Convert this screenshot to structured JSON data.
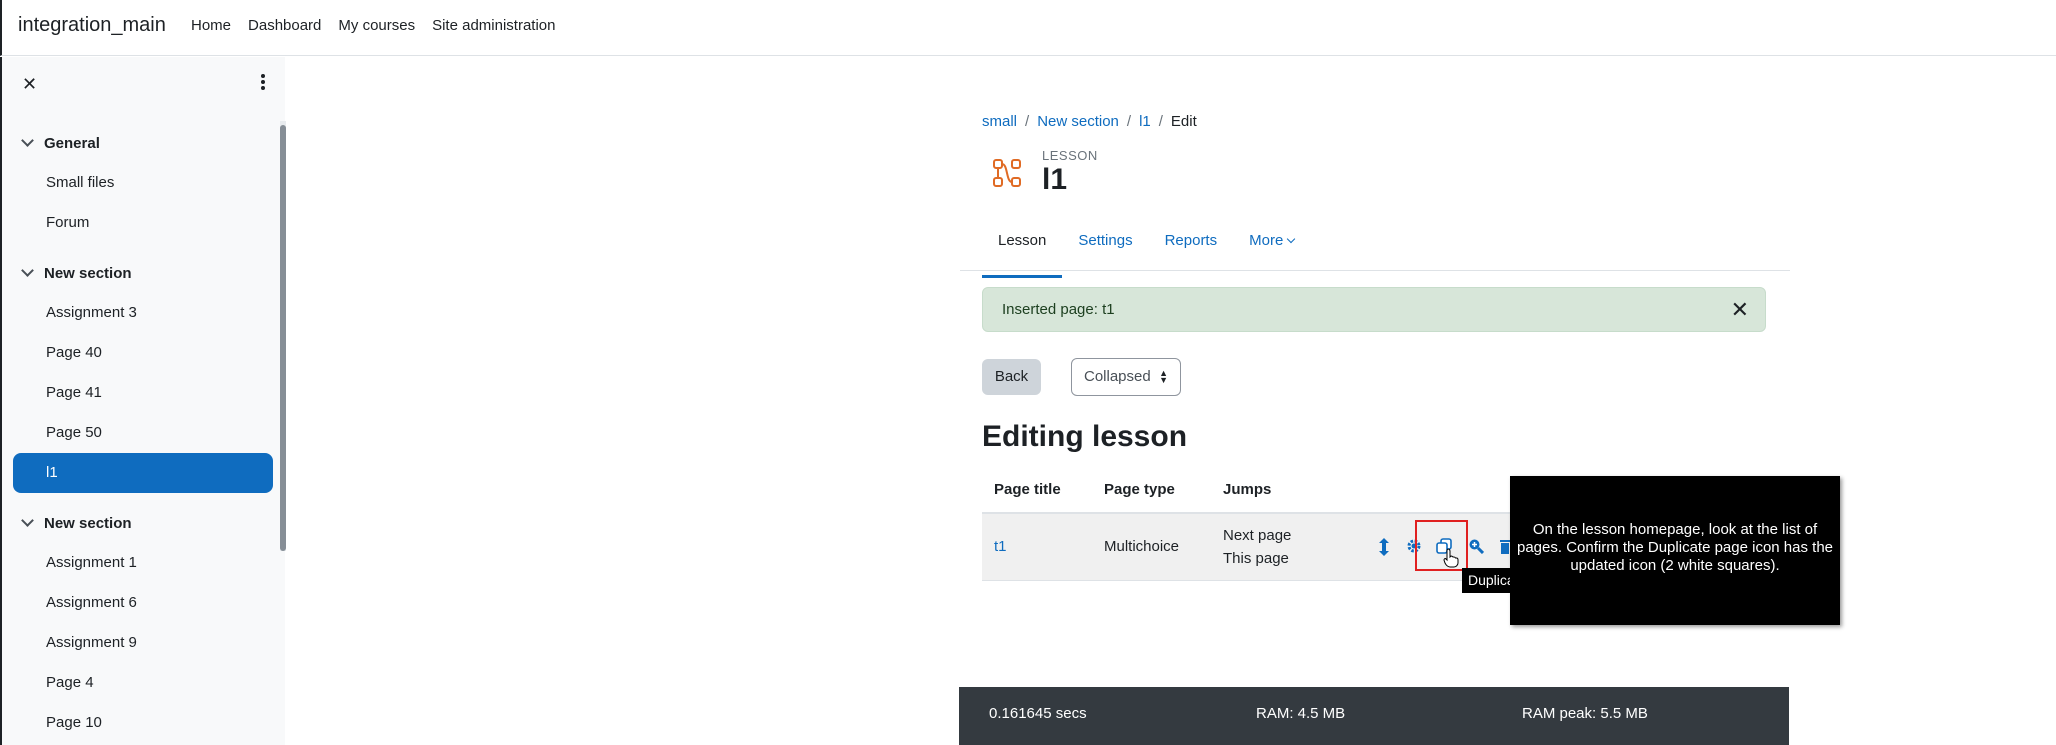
{
  "navbar": {
    "brand": "integration_main",
    "links": [
      "Home",
      "Dashboard",
      "My courses",
      "Site administration"
    ]
  },
  "drawer": {
    "sections": [
      {
        "title": "General",
        "items": [
          {
            "label": "Small files"
          },
          {
            "label": "Forum"
          }
        ]
      },
      {
        "title": "New section",
        "items": [
          {
            "label": "Assignment 3"
          },
          {
            "label": "Page 40"
          },
          {
            "label": "Page 41"
          },
          {
            "label": "Page 50"
          },
          {
            "label": "l1",
            "active": true
          }
        ]
      },
      {
        "title": "New section",
        "items": [
          {
            "label": "Assignment 1"
          },
          {
            "label": "Assignment 6"
          },
          {
            "label": "Assignment 9"
          },
          {
            "label": "Page 4"
          },
          {
            "label": "Page 10"
          }
        ]
      }
    ]
  },
  "breadcrumb": {
    "items": [
      "small",
      "New section",
      "l1"
    ],
    "current": "Edit",
    "separator": "/"
  },
  "module": {
    "type_label": "LESSON",
    "title": "l1"
  },
  "tabs": {
    "lesson": "Lesson",
    "settings": "Settings",
    "reports": "Reports",
    "more": "More"
  },
  "alert": {
    "text": "Inserted page: t1",
    "close": "✕"
  },
  "controls": {
    "back": "Back",
    "select_value": "Collapsed"
  },
  "heading": "Editing lesson",
  "table": {
    "headers": {
      "title": "Page title",
      "type": "Page type",
      "jumps": "Jumps"
    },
    "row": {
      "title": "t1",
      "type": "Multichoice",
      "jump1": "Next page",
      "jump2": "This page"
    }
  },
  "tooltip": "Duplicate",
  "instruction": "On the lesson homepage, look at the list of pages. Confirm the Duplicate page icon has the updated icon (2 white squares).",
  "footer": {
    "time": "0.161645 secs",
    "ram": "RAM: 4.5 MB",
    "ram_peak": "RAM peak: 5.5 MB"
  },
  "colors": {
    "brand_blue": "#0f6cbf",
    "alert_bg": "#d7e6d9",
    "footer_bg": "#343a40",
    "highlight": "#e02020"
  }
}
